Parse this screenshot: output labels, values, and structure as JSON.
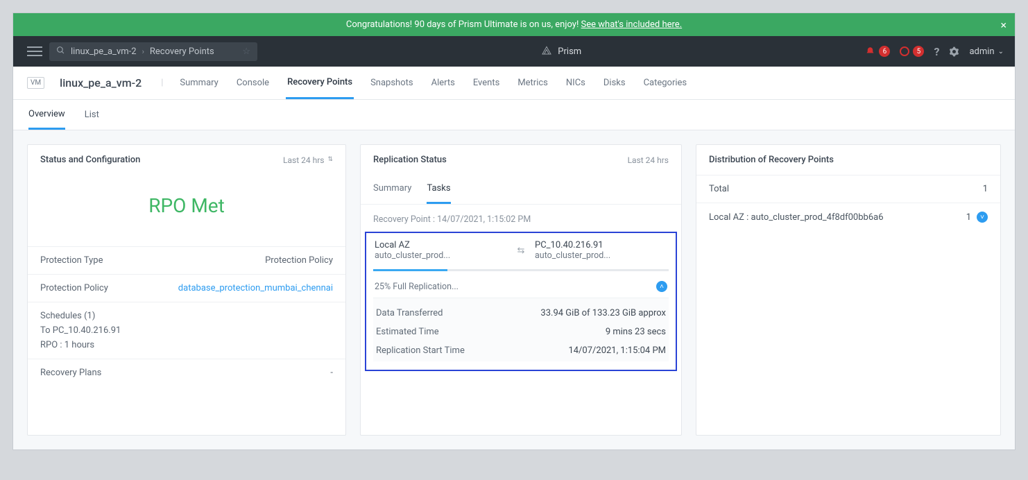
{
  "banner": {
    "text_prefix": "Congratulations! 90 days of Prism Ultimate is on us, enjoy! ",
    "link_text": "See what's included here."
  },
  "topbar": {
    "search_value": "linux_pe_a_vm-2",
    "breadcrumb_tail": "Recovery Points",
    "brand": "Prism",
    "alert_count": "6",
    "task_count": "5",
    "user": "admin"
  },
  "entity": {
    "type": "VM",
    "name": "linux_pe_a_vm-2",
    "tabs": [
      "Summary",
      "Console",
      "Recovery Points",
      "Snapshots",
      "Alerts",
      "Events",
      "Metrics",
      "NICs",
      "Disks",
      "Categories"
    ],
    "active_tab": "Recovery Points",
    "subtabs": [
      "Overview",
      "List"
    ],
    "active_subtab": "Overview"
  },
  "status_card": {
    "title": "Status and Configuration",
    "range": "Last  24 hrs",
    "rpo": "RPO Met",
    "rows": {
      "protection_type_k": "Protection Type",
      "protection_type_v": "Protection Policy",
      "protection_policy_k": "Protection Policy",
      "protection_policy_v": "database_protection_mumbai_chennai",
      "schedules_k": "Schedules (1)",
      "sched_line1": "To PC_10.40.216.91",
      "sched_line2": "RPO : 1 hours",
      "recovery_plans_k": "Recovery Plans",
      "recovery_plans_v": "-"
    }
  },
  "repl_card": {
    "title": "Replication Status",
    "range": "Last 24 hrs",
    "tabs": [
      "Summary",
      "Tasks"
    ],
    "active": "Tasks",
    "rp_label": "Recovery Point : 14/07/2021, 1:15:02 PM",
    "src_title": "Local AZ",
    "src_sub": "auto_cluster_prod...",
    "dst_title": "PC_10.40.216.91",
    "dst_sub": "auto_cluster_prod...",
    "progress_pct": 25,
    "progress_label": "25% Full Replication...",
    "details": {
      "data_transferred_k": "Data Transferred",
      "data_transferred_v": "33.94 GiB of 133.23 GiB approx",
      "est_time_k": "Estimated Time",
      "est_time_v": "9 mins 23 secs",
      "start_k": "Replication Start Time",
      "start_v": "14/07/2021, 1:15:04 PM"
    }
  },
  "dist_card": {
    "title": "Distribution of Recovery Points",
    "total_k": "Total",
    "total_v": "1",
    "row1_k": "Local AZ : auto_cluster_prod_4f8df00bb6a6",
    "row1_v": "1"
  }
}
